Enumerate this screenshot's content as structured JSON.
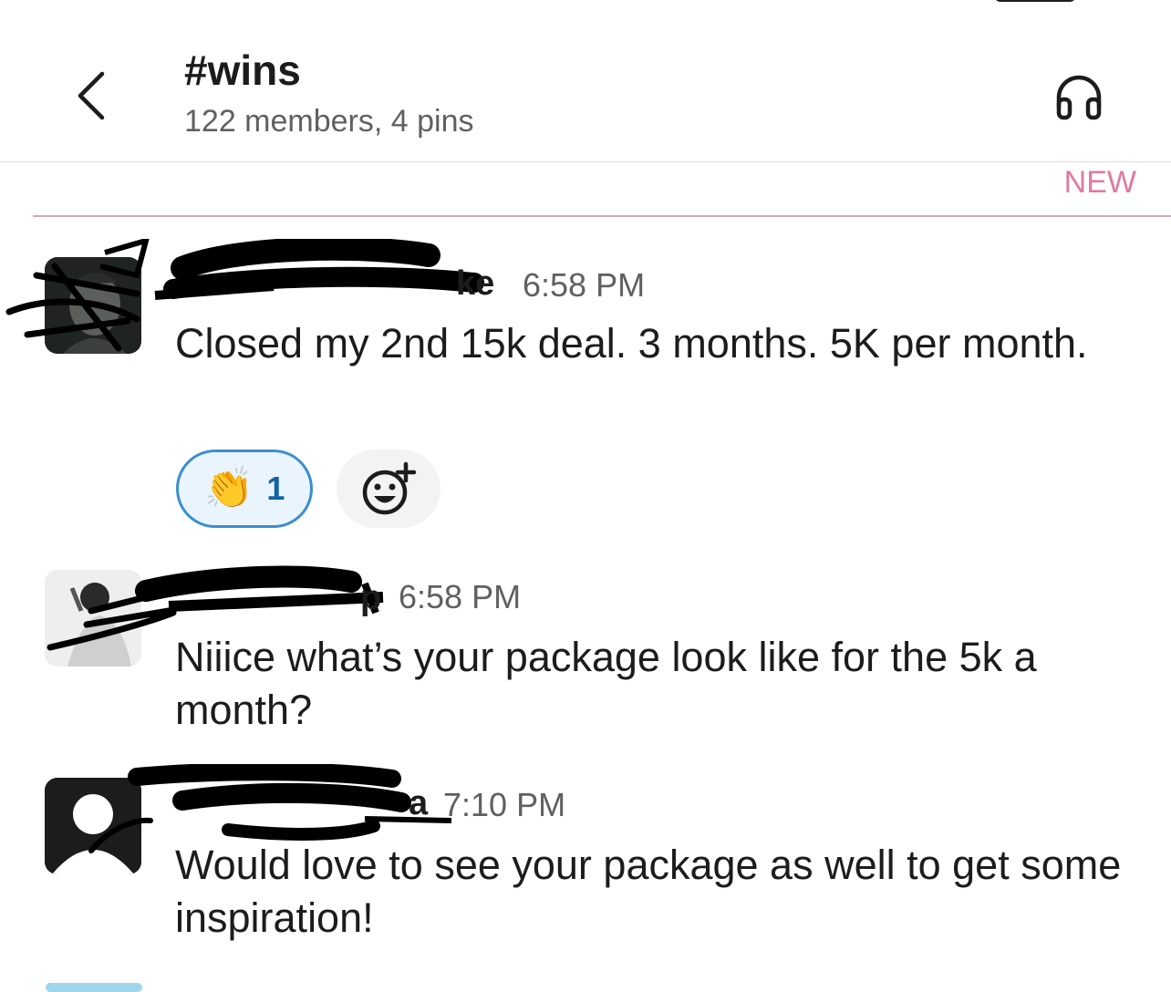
{
  "header": {
    "channel_name": "#wins",
    "channel_meta": "122 members, 4 pins",
    "back_icon": "chevron-left-icon",
    "huddle_icon": "headphones-icon"
  },
  "divider": {
    "new_label": "NEW",
    "color": "#e07ba0"
  },
  "messages": [
    {
      "sender_visible": "ke",
      "time": "6:58 PM",
      "text": "Closed my 2nd 15k deal. 3 months. 5K per month.",
      "reactions": [
        {
          "emoji": "👏",
          "count": "1"
        }
      ],
      "add_reaction_icon": "add-emoji-icon"
    },
    {
      "sender_visible": "p",
      "time": "6:58 PM",
      "text": "Niiice what’s your package look like for the 5k a month?"
    },
    {
      "sender_visible": "a",
      "time": "7:10 PM",
      "text": "Would love to see your package as well to get some inspiration!"
    }
  ],
  "colors": {
    "reaction_border": "#3b8ece",
    "reaction_bg": "#eaf4fc",
    "text_primary": "#1d1c1d",
    "text_secondary": "#616061"
  }
}
